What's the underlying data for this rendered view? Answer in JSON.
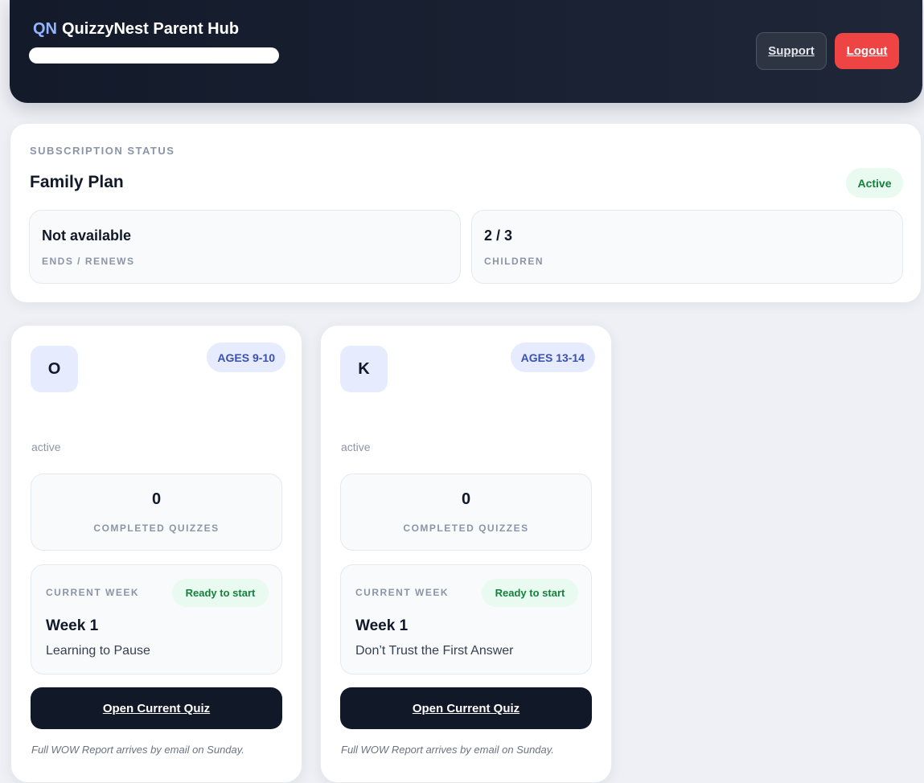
{
  "header": {
    "brand_mark": "QN",
    "brand_name": "QuizzyNest Parent Hub",
    "support_label": "Support",
    "logout_label": "Logout"
  },
  "subscription": {
    "eyebrow": "SUBSCRIPTION STATUS",
    "plan_name": "Family Plan",
    "status": "Active",
    "stats": [
      {
        "value": "Not available",
        "label": "ENDS / RENEWS"
      },
      {
        "value": "2 / 3",
        "label": "CHILDREN"
      }
    ]
  },
  "children": [
    {
      "initial": "O",
      "age_range": "AGES 9-10",
      "status": "active",
      "completed_quizzes": "0",
      "completed_label": "COMPLETED QUIZZES",
      "week_eyebrow": "CURRENT WEEK",
      "week_status": "Ready to start",
      "week_title": "Week 1",
      "week_topic": "Learning to Pause",
      "cta_label": "Open Current Quiz",
      "report_note": "Full WOW Report arrives by email on Sunday."
    },
    {
      "initial": "K",
      "age_range": "AGES 13-14",
      "status": "active",
      "completed_quizzes": "0",
      "completed_label": "COMPLETED QUIZZES",
      "week_eyebrow": "CURRENT WEEK",
      "week_status": "Ready to start",
      "week_title": "Week 1",
      "week_topic": "Don’t Trust the First Answer",
      "cta_label": "Open Current Quiz",
      "report_note": "Full WOW Report arrives by email on Sunday."
    }
  ],
  "colors": {
    "header_bg": "#131a2a",
    "brand_accent": "#93b4ff",
    "logout_red": "#ef4444",
    "active_green": "#15803d",
    "age_blue": "#3a51b0",
    "cta_dark": "#111827"
  }
}
